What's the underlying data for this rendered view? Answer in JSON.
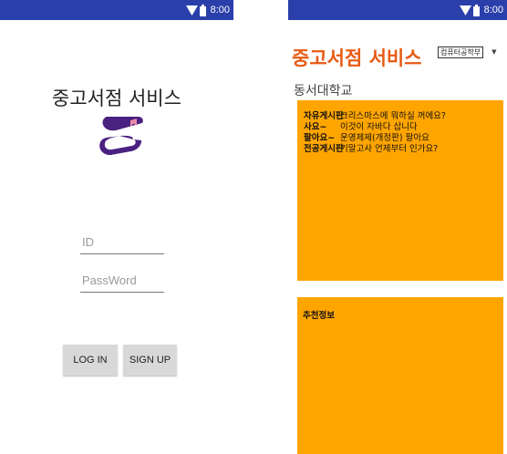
{
  "status_bar": {
    "time": "8:00",
    "color": "#2b3faa"
  },
  "login_screen": {
    "title": "중고서점 서비스",
    "logo_icon": "book-icon",
    "logo_color": "#4a2080",
    "id_placeholder": "ID",
    "password_placeholder": "PassWord",
    "login_label": "LOG IN",
    "signup_label": "SIGN UP"
  },
  "main_screen": {
    "app_title": "중고서점 서비스",
    "title_color": "#e85a13",
    "department_selected": "컴퓨터공학부",
    "school": "동서대학교",
    "panel_color": "#ffa500",
    "board_rows": [
      {
        "category": "자유게시판",
        "title": "크리스마스에 뭐하실 꺼에요?"
      },
      {
        "category": "사요~",
        "title": "이것이 자바다 삽니다"
      },
      {
        "category": "팔아요~",
        "title": "운영체제(개정판) 팔아요"
      },
      {
        "category": "전공게시판",
        "title": "기말고사 언제부터 인가요?"
      }
    ],
    "recommend_title": "추천정보"
  }
}
